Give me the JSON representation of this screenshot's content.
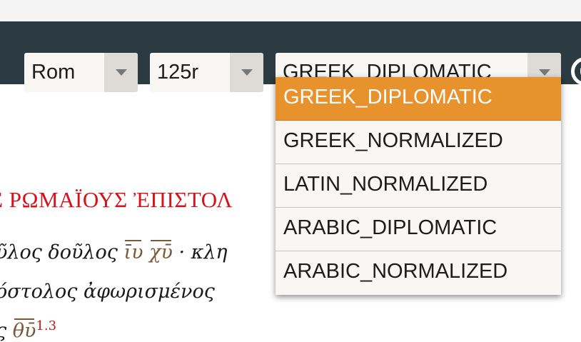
{
  "toolbar": {
    "book_select": {
      "value": "Rom"
    },
    "folio_select": {
      "value": "125r"
    },
    "view_select": {
      "value": "GREEK_DIPLOMATIC"
    }
  },
  "dropdown": {
    "options": [
      {
        "label": "GREEK_DIPLOMATIC",
        "selected": true
      },
      {
        "label": "GREEK_NORMALIZED",
        "selected": false
      },
      {
        "label": "LATIN_NORMALIZED",
        "selected": false
      },
      {
        "label": "ARABIC_DIPLOMATIC",
        "selected": false
      },
      {
        "label": "ARABIC_NORMALIZED",
        "selected": false
      }
    ]
  },
  "text": {
    "title": "Σ ΡΩΜΑΪΟΥΣ ἘΠΙΣΤΟΛ",
    "line1_a": "ῦλος δοῦλος ",
    "line1_abbr1": "ῑυ",
    "line1_space": " ",
    "line1_abbr2": "χῡ",
    "line1_b": " · κλη",
    "line2": "όστολος ἀφωρισμένος",
    "line3_a": "ς   ",
    "line3_abbr": "θῡ",
    "line3_num": "1.3"
  },
  "colors": {
    "toolbar_bg": "#2b3b41",
    "selected_option": "#e8922e",
    "title_red": "#d4141a"
  }
}
